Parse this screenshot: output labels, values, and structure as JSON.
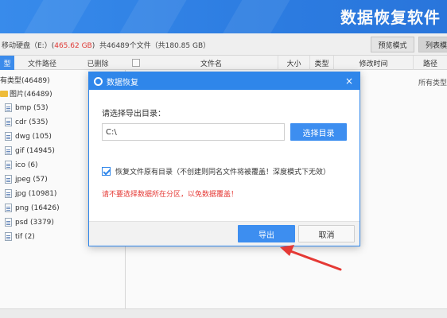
{
  "banner": {
    "brand": "数据恢复软件"
  },
  "infobar": {
    "drive_prefix": "移动硬盘（E:）(",
    "drive_size": "465.62 GB",
    "drive_suffix": ")",
    "summary": "共46489个文件（共180.85 GB）",
    "preview_btn": "预览模式",
    "list_btn": "列表模"
  },
  "left_tabs": [
    "型",
    "文件路径",
    "已删除"
  ],
  "tree": [
    {
      "label": "有类型(46489)",
      "kind": "root"
    },
    {
      "label": "图片(46489)",
      "kind": "folder"
    },
    {
      "label": "bmp (53)",
      "kind": "file"
    },
    {
      "label": "cdr (535)",
      "kind": "file"
    },
    {
      "label": "dwg (105)",
      "kind": "file"
    },
    {
      "label": "gif (14945)",
      "kind": "file"
    },
    {
      "label": "ico (6)",
      "kind": "file"
    },
    {
      "label": "jpeg (57)",
      "kind": "file"
    },
    {
      "label": "jpg (10981)",
      "kind": "file"
    },
    {
      "label": "png (16426)",
      "kind": "file"
    },
    {
      "label": "psd (3379)",
      "kind": "file"
    },
    {
      "label": "tif (2)",
      "kind": "file"
    }
  ],
  "columns": [
    "文件名",
    "大小",
    "类型",
    "修改时间",
    "路径"
  ],
  "row_type_text": "所有类型",
  "dialog": {
    "title": "数据恢复",
    "close": "×",
    "label": "请选择导出目录：",
    "path_value": "C:\\",
    "choose_btn": "选择目录",
    "option_text": "恢复文件原有目录（不创建则同名文件将被覆盖！深度模式下无效）",
    "option_checked": true,
    "warning": "请不要选择数据所在分区，以免数据覆盖！",
    "export_btn": "导出",
    "cancel_btn": "取消"
  },
  "colors": {
    "accent": "#2f86ea",
    "warning": "#e53935",
    "folder": "#f3c03c"
  }
}
